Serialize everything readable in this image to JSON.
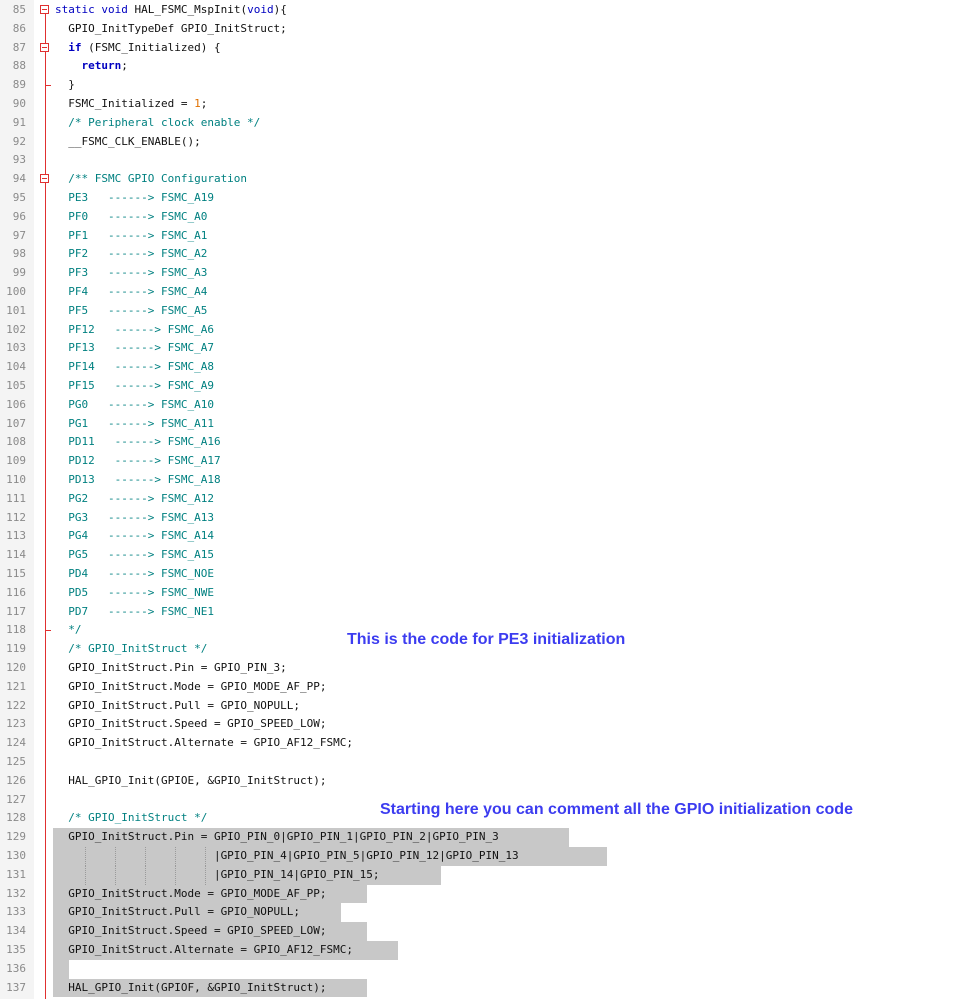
{
  "annotations": {
    "pe3": "This is the code for PE3 initialization",
    "comment_all": "Starting here you can comment all the GPIO initialization code"
  },
  "lines": [
    {
      "n": "85",
      "t": "static void HAL_FSMC_MspInit(void){"
    },
    {
      "n": "86",
      "t": "  GPIO_InitTypeDef GPIO_InitStruct;"
    },
    {
      "n": "87",
      "t": "  if (FSMC_Initialized) {"
    },
    {
      "n": "88",
      "t": "    return;"
    },
    {
      "n": "89",
      "t": "  }"
    },
    {
      "n": "90",
      "t": "  FSMC_Initialized = 1;"
    },
    {
      "n": "91",
      "t": "  /* Peripheral clock enable */"
    },
    {
      "n": "92",
      "t": "  __FSMC_CLK_ENABLE();"
    },
    {
      "n": "93",
      "t": ""
    },
    {
      "n": "94",
      "t": "  /** FSMC GPIO Configuration"
    },
    {
      "n": "95",
      "t": "  PE3   ------> FSMC_A19"
    },
    {
      "n": "96",
      "t": "  PF0   ------> FSMC_A0"
    },
    {
      "n": "97",
      "t": "  PF1   ------> FSMC_A1"
    },
    {
      "n": "98",
      "t": "  PF2   ------> FSMC_A2"
    },
    {
      "n": "99",
      "t": "  PF3   ------> FSMC_A3"
    },
    {
      "n": "100",
      "t": "  PF4   ------> FSMC_A4"
    },
    {
      "n": "101",
      "t": "  PF5   ------> FSMC_A5"
    },
    {
      "n": "102",
      "t": "  PF12   ------> FSMC_A6"
    },
    {
      "n": "103",
      "t": "  PF13   ------> FSMC_A7"
    },
    {
      "n": "104",
      "t": "  PF14   ------> FSMC_A8"
    },
    {
      "n": "105",
      "t": "  PF15   ------> FSMC_A9"
    },
    {
      "n": "106",
      "t": "  PG0   ------> FSMC_A10"
    },
    {
      "n": "107",
      "t": "  PG1   ------> FSMC_A11"
    },
    {
      "n": "108",
      "t": "  PD11   ------> FSMC_A16"
    },
    {
      "n": "109",
      "t": "  PD12   ------> FSMC_A17"
    },
    {
      "n": "110",
      "t": "  PD13   ------> FSMC_A18"
    },
    {
      "n": "111",
      "t": "  PG2   ------> FSMC_A12"
    },
    {
      "n": "112",
      "t": "  PG3   ------> FSMC_A13"
    },
    {
      "n": "113",
      "t": "  PG4   ------> FSMC_A14"
    },
    {
      "n": "114",
      "t": "  PG5   ------> FSMC_A15"
    },
    {
      "n": "115",
      "t": "  PD4   ------> FSMC_NOE"
    },
    {
      "n": "116",
      "t": "  PD5   ------> FSMC_NWE"
    },
    {
      "n": "117",
      "t": "  PD7   ------> FSMC_NE1"
    },
    {
      "n": "118",
      "t": "  */"
    },
    {
      "n": "119",
      "t": "  /* GPIO_InitStruct */"
    },
    {
      "n": "120",
      "t": "  GPIO_InitStruct.Pin = GPIO_PIN_3;"
    },
    {
      "n": "121",
      "t": "  GPIO_InitStruct.Mode = GPIO_MODE_AF_PP;"
    },
    {
      "n": "122",
      "t": "  GPIO_InitStruct.Pull = GPIO_NOPULL;"
    },
    {
      "n": "123",
      "t": "  GPIO_InitStruct.Speed = GPIO_SPEED_LOW;"
    },
    {
      "n": "124",
      "t": "  GPIO_InitStruct.Alternate = GPIO_AF12_FSMC;"
    },
    {
      "n": "125",
      "t": ""
    },
    {
      "n": "126",
      "t": "  HAL_GPIO_Init(GPIOE, &GPIO_InitStruct);"
    },
    {
      "n": "127",
      "t": ""
    },
    {
      "n": "128",
      "t": "  /* GPIO_InitStruct */"
    },
    {
      "n": "129",
      "t": "  GPIO_InitStruct.Pin = GPIO_PIN_0|GPIO_PIN_1|GPIO_PIN_2|GPIO_PIN_3"
    },
    {
      "n": "130",
      "t": "                        |GPIO_PIN_4|GPIO_PIN_5|GPIO_PIN_12|GPIO_PIN_13"
    },
    {
      "n": "131",
      "t": "                        |GPIO_PIN_14|GPIO_PIN_15;"
    },
    {
      "n": "132",
      "t": "  GPIO_InitStruct.Mode = GPIO_MODE_AF_PP;"
    },
    {
      "n": "133",
      "t": "  GPIO_InitStruct.Pull = GPIO_NOPULL;"
    },
    {
      "n": "134",
      "t": "  GPIO_InitStruct.Speed = GPIO_SPEED_LOW;"
    },
    {
      "n": "135",
      "t": "  GPIO_InitStruct.Alternate = GPIO_AF12_FSMC;"
    },
    {
      "n": "136",
      "t": ""
    },
    {
      "n": "137",
      "t": "  HAL_GPIO_Init(GPIOF, &GPIO_InitStruct);"
    }
  ]
}
